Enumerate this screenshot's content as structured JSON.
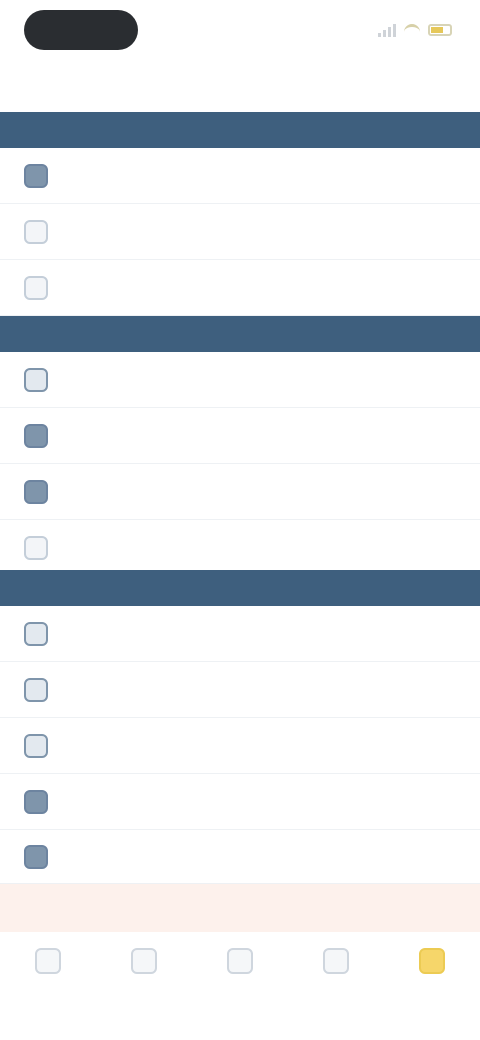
{
  "status_bar": {
    "time": ""
  },
  "header": {
    "title": ""
  },
  "sections": [
    {
      "title": "",
      "items": [
        {
          "label": "",
          "icon": "app-icon"
        },
        {
          "label": "",
          "icon": "app-icon"
        },
        {
          "label": "",
          "icon": "app-icon"
        }
      ]
    },
    {
      "title": "",
      "items": [
        {
          "label": "",
          "icon": "app-icon"
        },
        {
          "label": "",
          "icon": "app-icon"
        },
        {
          "label": "",
          "icon": "app-icon"
        },
        {
          "label": "",
          "icon": "app-icon"
        }
      ]
    },
    {
      "title": "",
      "items": [
        {
          "label": "",
          "icon": "app-icon"
        },
        {
          "label": "",
          "icon": "app-icon"
        },
        {
          "label": "",
          "icon": "app-icon"
        },
        {
          "label": "",
          "icon": "app-icon"
        },
        {
          "label": "",
          "icon": "app-icon"
        }
      ]
    }
  ],
  "banner": {
    "text": ""
  },
  "tabs": [
    {
      "label": "",
      "icon": "tab-icon",
      "active": false
    },
    {
      "label": "",
      "icon": "tab-icon",
      "active": false
    },
    {
      "label": "",
      "icon": "tab-icon",
      "active": false
    },
    {
      "label": "",
      "icon": "tab-icon",
      "active": false
    },
    {
      "label": "",
      "icon": "tab-icon",
      "active": true
    }
  ],
  "colors": {
    "section_header": "#3e5f7e",
    "banner_bg": "#fdf1ec",
    "active_tab": "#f6d66a"
  }
}
